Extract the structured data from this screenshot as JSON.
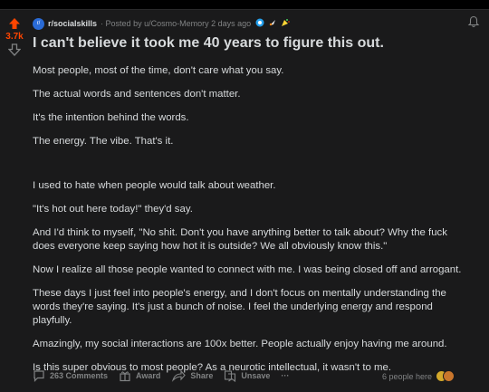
{
  "vote": {
    "count": "3.7k"
  },
  "meta": {
    "subreddit": "r/socialskills",
    "posted_by": "· Posted by u/Cosmo-Memory 2 days ago",
    "sub_icon_text": "r/"
  },
  "post": {
    "title": "I can't believe it took me 40 years to figure this out.",
    "paragraphs": [
      "Most people, most of the time, don't care what you say.",
      "The actual words and sentences don't matter.",
      "It's the intention behind the words.",
      "The energy. The vibe. That's it.",
      "I used to hate when people would talk about weather.",
      "\"It's hot out here today!\" they'd say.",
      "And I'd think to myself, \"No shit. Don't you have anything better to talk about? Why the fuck does everyone keep saying how hot it is outside? We all obviously know this.\"",
      "Now I realize all those people wanted to connect with me. I was being closed off and arrogant.",
      "These days I just feel into people's energy, and I don't focus on mentally understanding the words they're saying. It's just a bunch of noise. I feel the underlying energy and respond playfully.",
      "Amazingly, my social interactions are 100x better. People actually enjoy having me around.",
      "Is this super obvious to most people? As a neurotic intellectual, it wasn't to me."
    ]
  },
  "actions": {
    "comments": "263 Comments",
    "award": "Award",
    "share": "Share",
    "unsave": "Unsave",
    "more": "···"
  },
  "presence": {
    "text": "6 people here"
  },
  "colors": {
    "upvote": "#ff4500",
    "background": "#1a1a1b",
    "text": "#d7dadc",
    "muted": "#818384"
  }
}
